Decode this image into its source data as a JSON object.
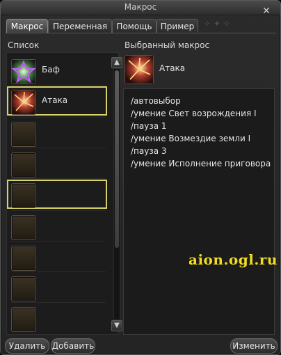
{
  "window": {
    "title": "Макрос",
    "close_label": "✕"
  },
  "tabs": [
    {
      "label": "Макрос",
      "active": true
    },
    {
      "label": "Переменная",
      "active": false
    },
    {
      "label": "Помощь",
      "active": false
    },
    {
      "label": "Пример",
      "active": false
    }
  ],
  "list": {
    "label": "Список",
    "items": [
      {
        "name": "Баф",
        "icon": "buff-star-icon",
        "selected": false
      },
      {
        "name": "Атака",
        "icon": "attack-burst-icon",
        "selected": true
      },
      {
        "name": "",
        "icon": "empty-slot",
        "selected": false
      },
      {
        "name": "",
        "icon": "empty-slot",
        "selected": false
      },
      {
        "name": "",
        "icon": "empty-slot",
        "selected": false
      },
      {
        "name": "",
        "icon": "empty-slot",
        "selected": false
      },
      {
        "name": "",
        "icon": "empty-slot",
        "selected": false
      },
      {
        "name": "",
        "icon": "empty-slot",
        "selected": false
      },
      {
        "name": "",
        "icon": "empty-slot",
        "selected": false
      }
    ]
  },
  "selected_macro": {
    "label": "Выбранный макрос",
    "name": "Атака",
    "icon": "attack-burst-icon",
    "text": "/автовыбор\n/умение Свет возрождения I\n/пауза 1\n/умение Возмездие земли I\n/пауза 3\n/умение Исполнение приговора"
  },
  "buttons": {
    "delete": "Удалить",
    "add": "Добавить",
    "edit": "Изменить"
  },
  "watermark": "aion.ogl.ru",
  "colors": {
    "selection_border": "#d7d36a",
    "watermark": "#f2dd22"
  }
}
